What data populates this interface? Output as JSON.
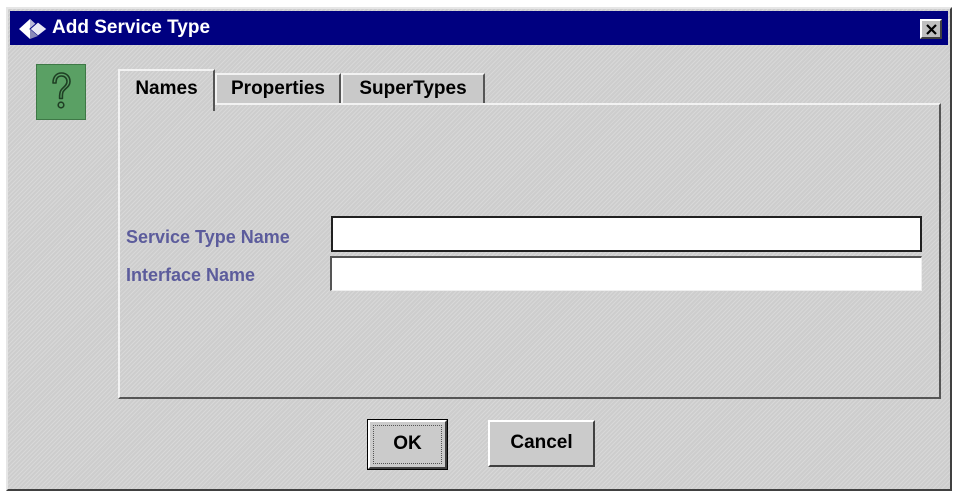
{
  "window": {
    "title": "Add Service Type",
    "title_icon": "diamond-app-icon",
    "close_icon": "close-icon"
  },
  "help": {
    "icon": "question-mark-icon",
    "icon_color": "#5aa064"
  },
  "tabs": [
    {
      "label": "Names",
      "active": true
    },
    {
      "label": "Properties",
      "active": false
    },
    {
      "label": "SuperTypes",
      "active": false
    }
  ],
  "form": {
    "service_type_name": {
      "label": "Service Type Name",
      "value": ""
    },
    "interface_name": {
      "label": "Interface Name",
      "value": ""
    }
  },
  "buttons": {
    "ok_label": "OK",
    "cancel_label": "Cancel"
  },
  "colors": {
    "titlebar": "#000080",
    "label_text": "#5c5c9c",
    "dialog_bg": "#cdcdcd"
  }
}
